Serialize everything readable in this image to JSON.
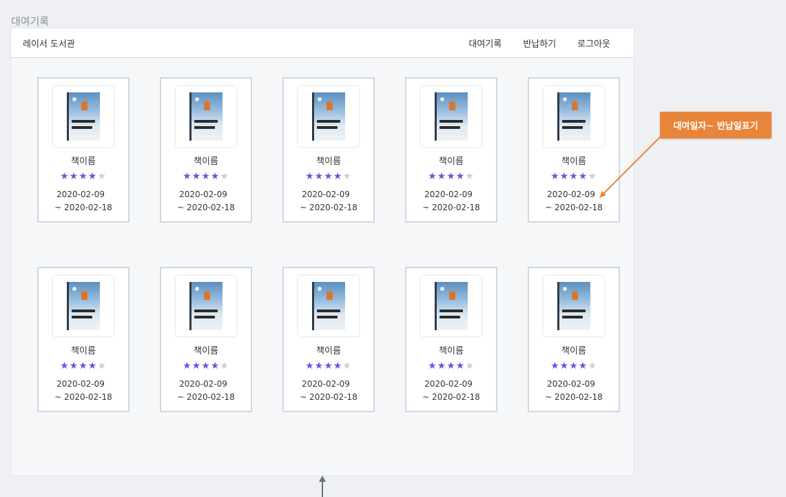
{
  "page_caption": "대여기록",
  "navbar": {
    "brand": "레이서 도서관",
    "links": [
      "대여기록",
      "반납하기",
      "로그아웃"
    ]
  },
  "books": [
    {
      "title": "책이름",
      "rating": 4,
      "max_rating": 5,
      "rent_date": "2020-02-09",
      "return_date": "~ 2020-02-18"
    },
    {
      "title": "책이름",
      "rating": 4,
      "max_rating": 5,
      "rent_date": "2020-02-09",
      "return_date": "~ 2020-02-18"
    },
    {
      "title": "책이름",
      "rating": 4,
      "max_rating": 5,
      "rent_date": "2020-02-09",
      "return_date": "~ 2020-02-18"
    },
    {
      "title": "책이름",
      "rating": 4,
      "max_rating": 5,
      "rent_date": "2020-02-09",
      "return_date": "~ 2020-02-18"
    },
    {
      "title": "책이름",
      "rating": 4,
      "max_rating": 5,
      "rent_date": "2020-02-09",
      "return_date": "~ 2020-02-18"
    },
    {
      "title": "책이름",
      "rating": 4,
      "max_rating": 5,
      "rent_date": "2020-02-09",
      "return_date": "~ 2020-02-18"
    },
    {
      "title": "책이름",
      "rating": 4,
      "max_rating": 5,
      "rent_date": "2020-02-09",
      "return_date": "~ 2020-02-18"
    },
    {
      "title": "책이름",
      "rating": 4,
      "max_rating": 5,
      "rent_date": "2020-02-09",
      "return_date": "~ 2020-02-18"
    },
    {
      "title": "책이름",
      "rating": 4,
      "max_rating": 5,
      "rent_date": "2020-02-09",
      "return_date": "~ 2020-02-18"
    },
    {
      "title": "책이름",
      "rating": 4,
      "max_rating": 5,
      "rent_date": "2020-02-09",
      "return_date": "~ 2020-02-18"
    }
  ],
  "annotation": {
    "label": "대여일자~ 반납일표기",
    "color": "#e9843b"
  },
  "colors": {
    "star_filled": "#6557e0",
    "star_empty": "#c9ced6",
    "card_border": "#cfd7e0"
  }
}
